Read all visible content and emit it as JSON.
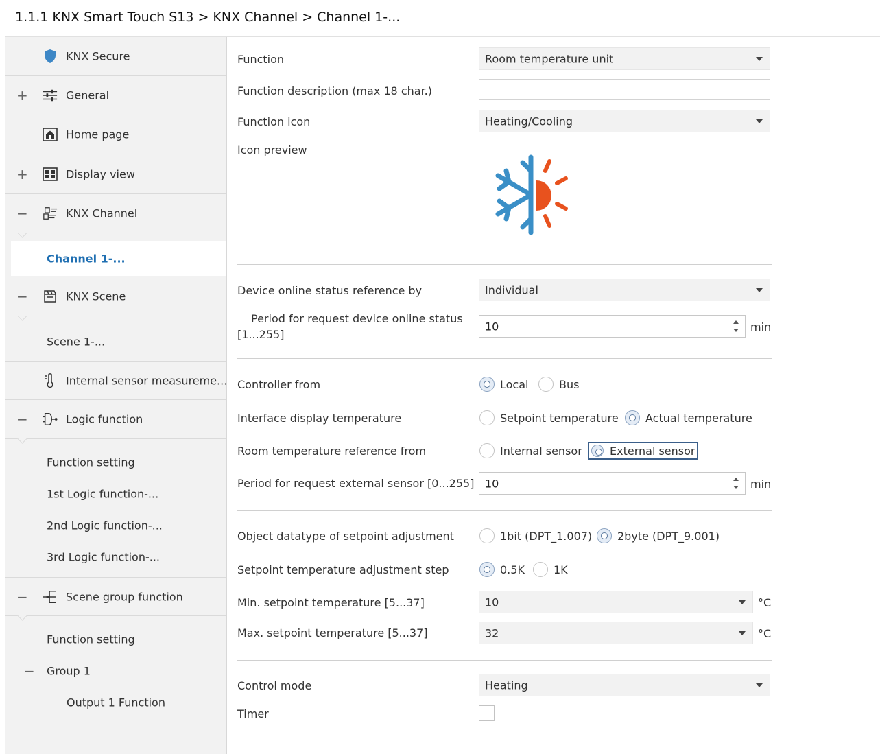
{
  "breadcrumb": "1.1.1 KNX Smart Touch S13 > KNX Channel  > Channel 1-...",
  "sidebar": {
    "knx_secure": "KNX Secure",
    "general": "General",
    "home_page": "Home page",
    "display_view": "Display view",
    "knx_channel": "KNX Channel",
    "channel_1": "Channel 1-...",
    "knx_scene": "KNX Scene",
    "scene_1": "Scene 1-...",
    "internal_sensor": "Internal sensor measureme...",
    "logic_function": "Logic function",
    "logic_function_setting": "Function setting",
    "logic_1": "1st Logic function-...",
    "logic_2": "2nd Logic function-...",
    "logic_3": "3rd Logic function-...",
    "scene_group_function": "Scene group function",
    "scene_group_function_setting": "Function setting",
    "group_1": "Group 1",
    "output_1": "Output 1 Function",
    "plus": "+",
    "minus": "−"
  },
  "form": {
    "function_label": "Function",
    "function_value": "Room temperature unit",
    "function_desc_label": "Function description (max 18 char.)",
    "function_desc_value": "",
    "function_icon_label": "Function icon",
    "function_icon_value": "Heating/Cooling",
    "icon_preview_label": "Icon preview",
    "online_status_label": "Device online status reference by",
    "online_status_value": "Individual",
    "period_online_label_1": "Period for request device online status",
    "period_online_label_2": "[1...255]",
    "period_online_value": "10",
    "period_online_unit": "min",
    "controller_from_label": "Controller from",
    "controller_local": "Local",
    "controller_bus": "Bus",
    "interface_temp_label": "Interface display temperature",
    "interface_setpoint": "Setpoint temperature",
    "interface_actual": "Actual temperature",
    "room_temp_ref_label": "Room temperature reference from",
    "room_internal": "Internal sensor",
    "room_external": "External sensor",
    "period_external_label": "Period for request external sensor [0...255]",
    "period_external_value": "10",
    "period_external_unit": "min",
    "datatype_label": "Object datatype of setpoint adjustment",
    "datatype_1bit": "1bit (DPT_1.007)",
    "datatype_2byte": "2byte (DPT_9.001)",
    "step_label": "Setpoint temperature adjustment step",
    "step_05": "0.5K",
    "step_1": "1K",
    "min_setpoint_label": "Min. setpoint temperature [5...37]",
    "min_setpoint_value": "10",
    "min_setpoint_unit": "°C",
    "max_setpoint_label": "Max. setpoint temperature [5...37]",
    "max_setpoint_value": "32",
    "max_setpoint_unit": "°C",
    "control_mode_label": "Control mode",
    "control_mode_value": "Heating",
    "timer_label": "Timer"
  },
  "colors": {
    "active_nav": "#1f6fb2",
    "snowflake": "#3a8fc7",
    "sun": "#e8521e"
  }
}
